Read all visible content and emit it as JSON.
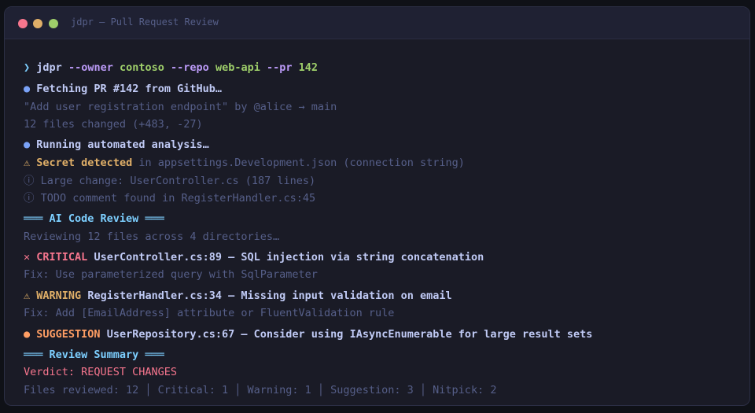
{
  "window": {
    "title": "jdpr — Pull Request Review"
  },
  "command": {
    "prompt": "❯",
    "program": "jdpr",
    "owner_flag": "--owner",
    "owner_value": "contoso",
    "repo_flag": "--repo",
    "repo_value": "web-api",
    "pr_flag": "--pr",
    "pr_value": "142"
  },
  "fetch": {
    "bullet": "●",
    "text": "Fetching PR #142 from GitHub…",
    "title_line": "\"Add user registration endpoint\" by @alice → main",
    "files_line": "12 files changed (+483, -27)"
  },
  "analysis": {
    "bullet": "●",
    "text": "Running automated analysis…",
    "secret_icon": "⚠",
    "secret_label": "Secret detected",
    "secret_detail": " in appsettings.Development.json (connection string)",
    "info_icon": "ⓘ",
    "info1": "Large change: UserController.cs (187 lines)",
    "info2": "TODO comment found in RegisterHandler.cs:45"
  },
  "ai_review": {
    "header": "═══ AI Code Review ═══",
    "reviewing": "Reviewing 12 files across 4 directories…",
    "findings": [
      {
        "icon": "✕",
        "severity": "CRITICAL",
        "location": "UserController.cs:89",
        "message": " — SQL injection via string concatenation",
        "fix": "Fix: Use parameterized query with SqlParameter"
      },
      {
        "icon": "⚠",
        "severity": "WARNING",
        "location": "RegisterHandler.cs:34",
        "message": " — Missing input validation on email",
        "fix": "Fix: Add [EmailAddress] attribute or FluentValidation rule"
      },
      {
        "icon": "●",
        "severity": "SUGGESTION",
        "location": "UserRepository.cs:67",
        "message": " — Consider using IAsyncEnumerable for large result sets"
      }
    ]
  },
  "summary": {
    "header": "═══ Review Summary ═══",
    "verdict": "Verdict: REQUEST CHANGES",
    "stats": "Files reviewed: 12 │ Critical: 1 │ Warning: 1 │ Suggestion: 3 │ Nitpick: 2"
  },
  "colors": {
    "background": "#1a1b26",
    "prompt": "#7dcfff",
    "flag": "#bb9af7",
    "value": "#9ece6a",
    "critical": "#f7768e",
    "warning": "#e0af68",
    "suggestion": "#ff9e64",
    "header": "#7dcfff",
    "bullet": "#7aa2f7"
  }
}
